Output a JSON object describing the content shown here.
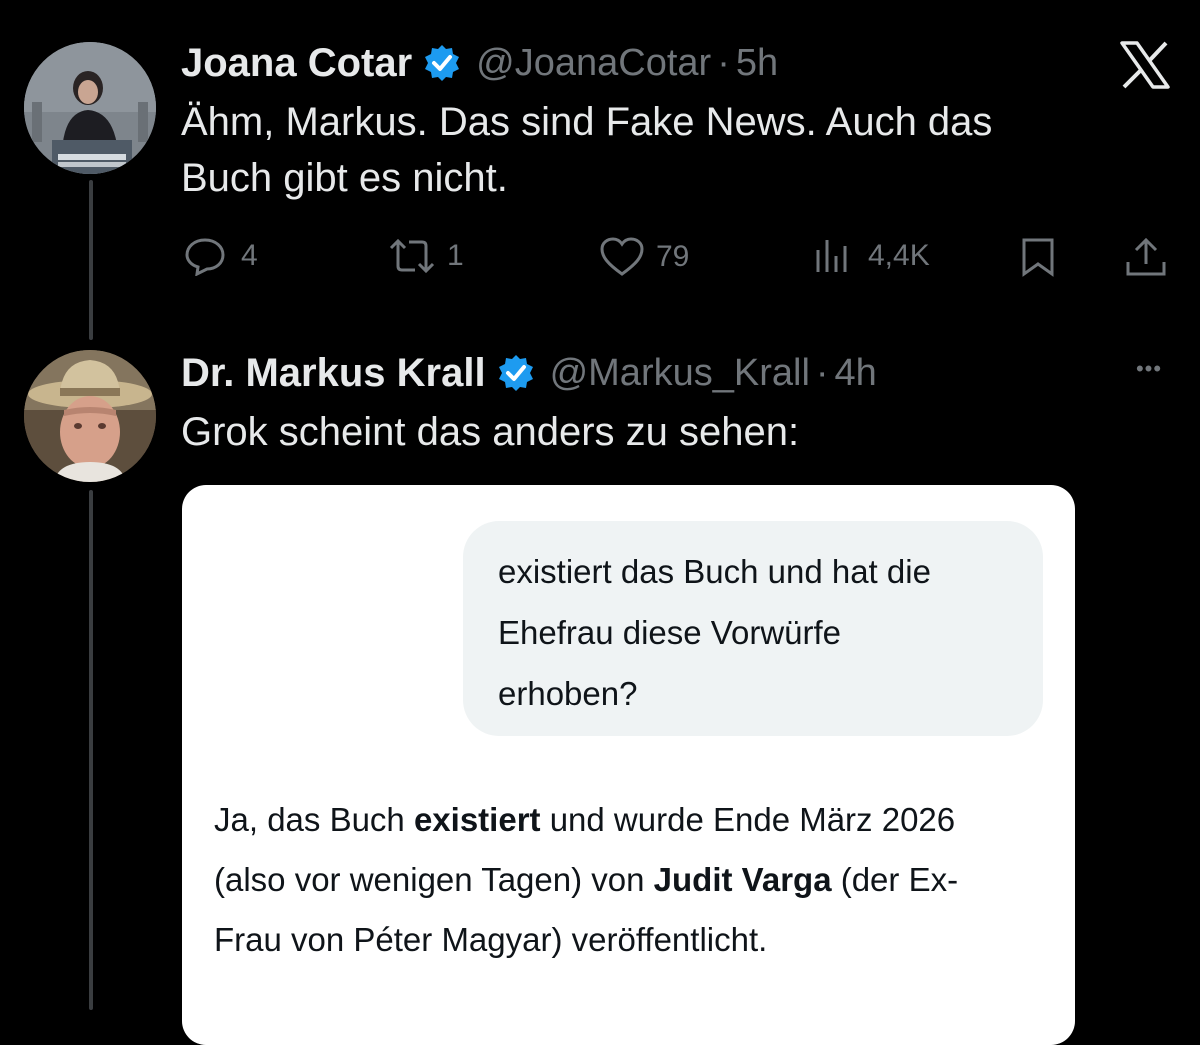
{
  "close_label": "X",
  "tweets": [
    {
      "display_name": "Joana Cotar",
      "handle": "@JoanaCotar",
      "separator": "·",
      "time": "5h",
      "text_line1": "Ähm, Markus. Das sind Fake News. Auch das",
      "text_line2": "Buch gibt es nicht.",
      "avatar_icon": "speaker-at-podium-photo",
      "stats": {
        "replies": "4",
        "reposts": "1",
        "likes": "79",
        "views": "4,4K"
      }
    },
    {
      "display_name": "Dr. Markus Krall",
      "handle": "@Markus_Krall",
      "separator": "·",
      "time": "4h",
      "more_label": "•••",
      "text": "Grok scheint das anders zu sehen:",
      "avatar_icon": "man-with-hat-photo"
    }
  ],
  "embed": {
    "question_line1": "existiert das Buch und hat die",
    "question_line2": "Ehefrau diese Vorwürfe",
    "question_line3": "erhoben?",
    "answer_part1": "Ja, das Buch ",
    "answer_bold1": "existiert",
    "answer_part2": " und wurde Ende März 2026",
    "answer_part3": "(also vor wenigen Tagen) von ",
    "answer_bold2": "Judit Varga",
    "answer_part4": " (der Ex-",
    "answer_part5": "Frau von Péter Magyar) veröffentlicht."
  },
  "colors": {
    "background": "#000000",
    "text": "#e7e9ea",
    "muted": "#71767b",
    "verified": "#1d9bf0"
  }
}
